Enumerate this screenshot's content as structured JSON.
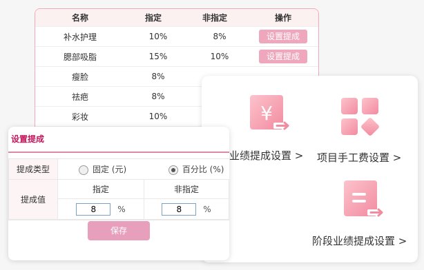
{
  "table": {
    "headers": [
      "名称",
      "指定",
      "非指定",
      "操作"
    ],
    "rows": [
      {
        "name": "补水护理",
        "designated": "10%",
        "non_designated": "8%",
        "action": "设置提成"
      },
      {
        "name": "腮部吸脂",
        "designated": "15%",
        "non_designated": "10%",
        "action": "设置提成"
      },
      {
        "name": "瘦脸",
        "designated": "8%",
        "non_designated": "",
        "action": ""
      },
      {
        "name": "祛疤",
        "designated": "8%",
        "non_designated": "",
        "action": ""
      },
      {
        "name": "彩妆",
        "designated": "10%",
        "non_designated": "",
        "action": ""
      }
    ]
  },
  "settings": {
    "tiles": [
      {
        "label": "业绩提成设置 >",
        "icon": "yen-doc-icon"
      },
      {
        "label": "项目手工费设置 >",
        "icon": "blocks-icon"
      },
      {
        "label": "阶段业绩提成设置 >",
        "icon": "doc-arrow-icon"
      }
    ]
  },
  "dialog": {
    "title": "设置提成",
    "type_label": "提成类型",
    "option_fixed": "固定 (元)",
    "option_percent": "百分比 (%)",
    "selected": "percent",
    "value_label": "提成值",
    "col_designated": "指定",
    "col_non_designated": "非指定",
    "designated_value": "8",
    "non_designated_value": "8",
    "unit": "%",
    "save_label": "保存"
  },
  "colors": {
    "accent": "#eea7bd",
    "title": "#c2185b",
    "icon_light": "#fbb8c4",
    "icon_dark": "#f28ba0"
  }
}
